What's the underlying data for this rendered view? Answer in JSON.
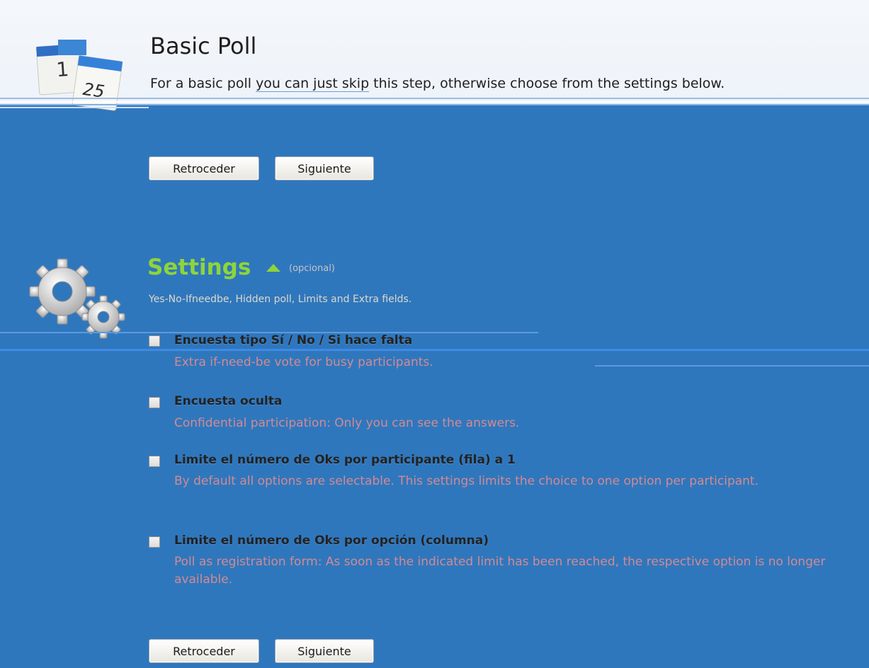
{
  "header": {
    "title": "Basic Poll",
    "description_prefix": "For a basic poll ",
    "description_link": "you can just skip",
    "description_suffix": " this step, otherwise choose from the settings below.",
    "calendar_day_back": "1",
    "calendar_day_front": "25"
  },
  "nav_top": {
    "back_label": "Retroceder",
    "next_label": "Siguiente"
  },
  "settings": {
    "title": "Settings",
    "optional": "(opcional)",
    "subtitle": "Yes-No-Ifneedbe, Hidden poll, Limits and Extra fields.",
    "options": [
      {
        "label": "Encuesta tipo Sí / No / Si hace falta",
        "desc": "Extra if-need-be vote for busy participants.",
        "checked": false
      },
      {
        "label": "Encuesta oculta",
        "desc": "Confidential participation: Only you can see the answers.",
        "checked": false
      },
      {
        "label": "Limite el número de Oks por participante (fila) a 1",
        "desc": "By default all options are selectable. This settings limits the choice to one option per participant.",
        "checked": false
      },
      {
        "label": "Limite el número de Oks por opción (columna)",
        "desc": "Poll as registration form: As soon as the indicated limit has been reached, the respective option is no longer available.",
        "checked": false
      }
    ]
  },
  "nav_bottom": {
    "back_label": "Retroceder",
    "next_label": "Siguiente"
  },
  "colors": {
    "background": "#2f77bd",
    "settings_title": "#8fd43a",
    "option_desc": "#d38a91"
  }
}
